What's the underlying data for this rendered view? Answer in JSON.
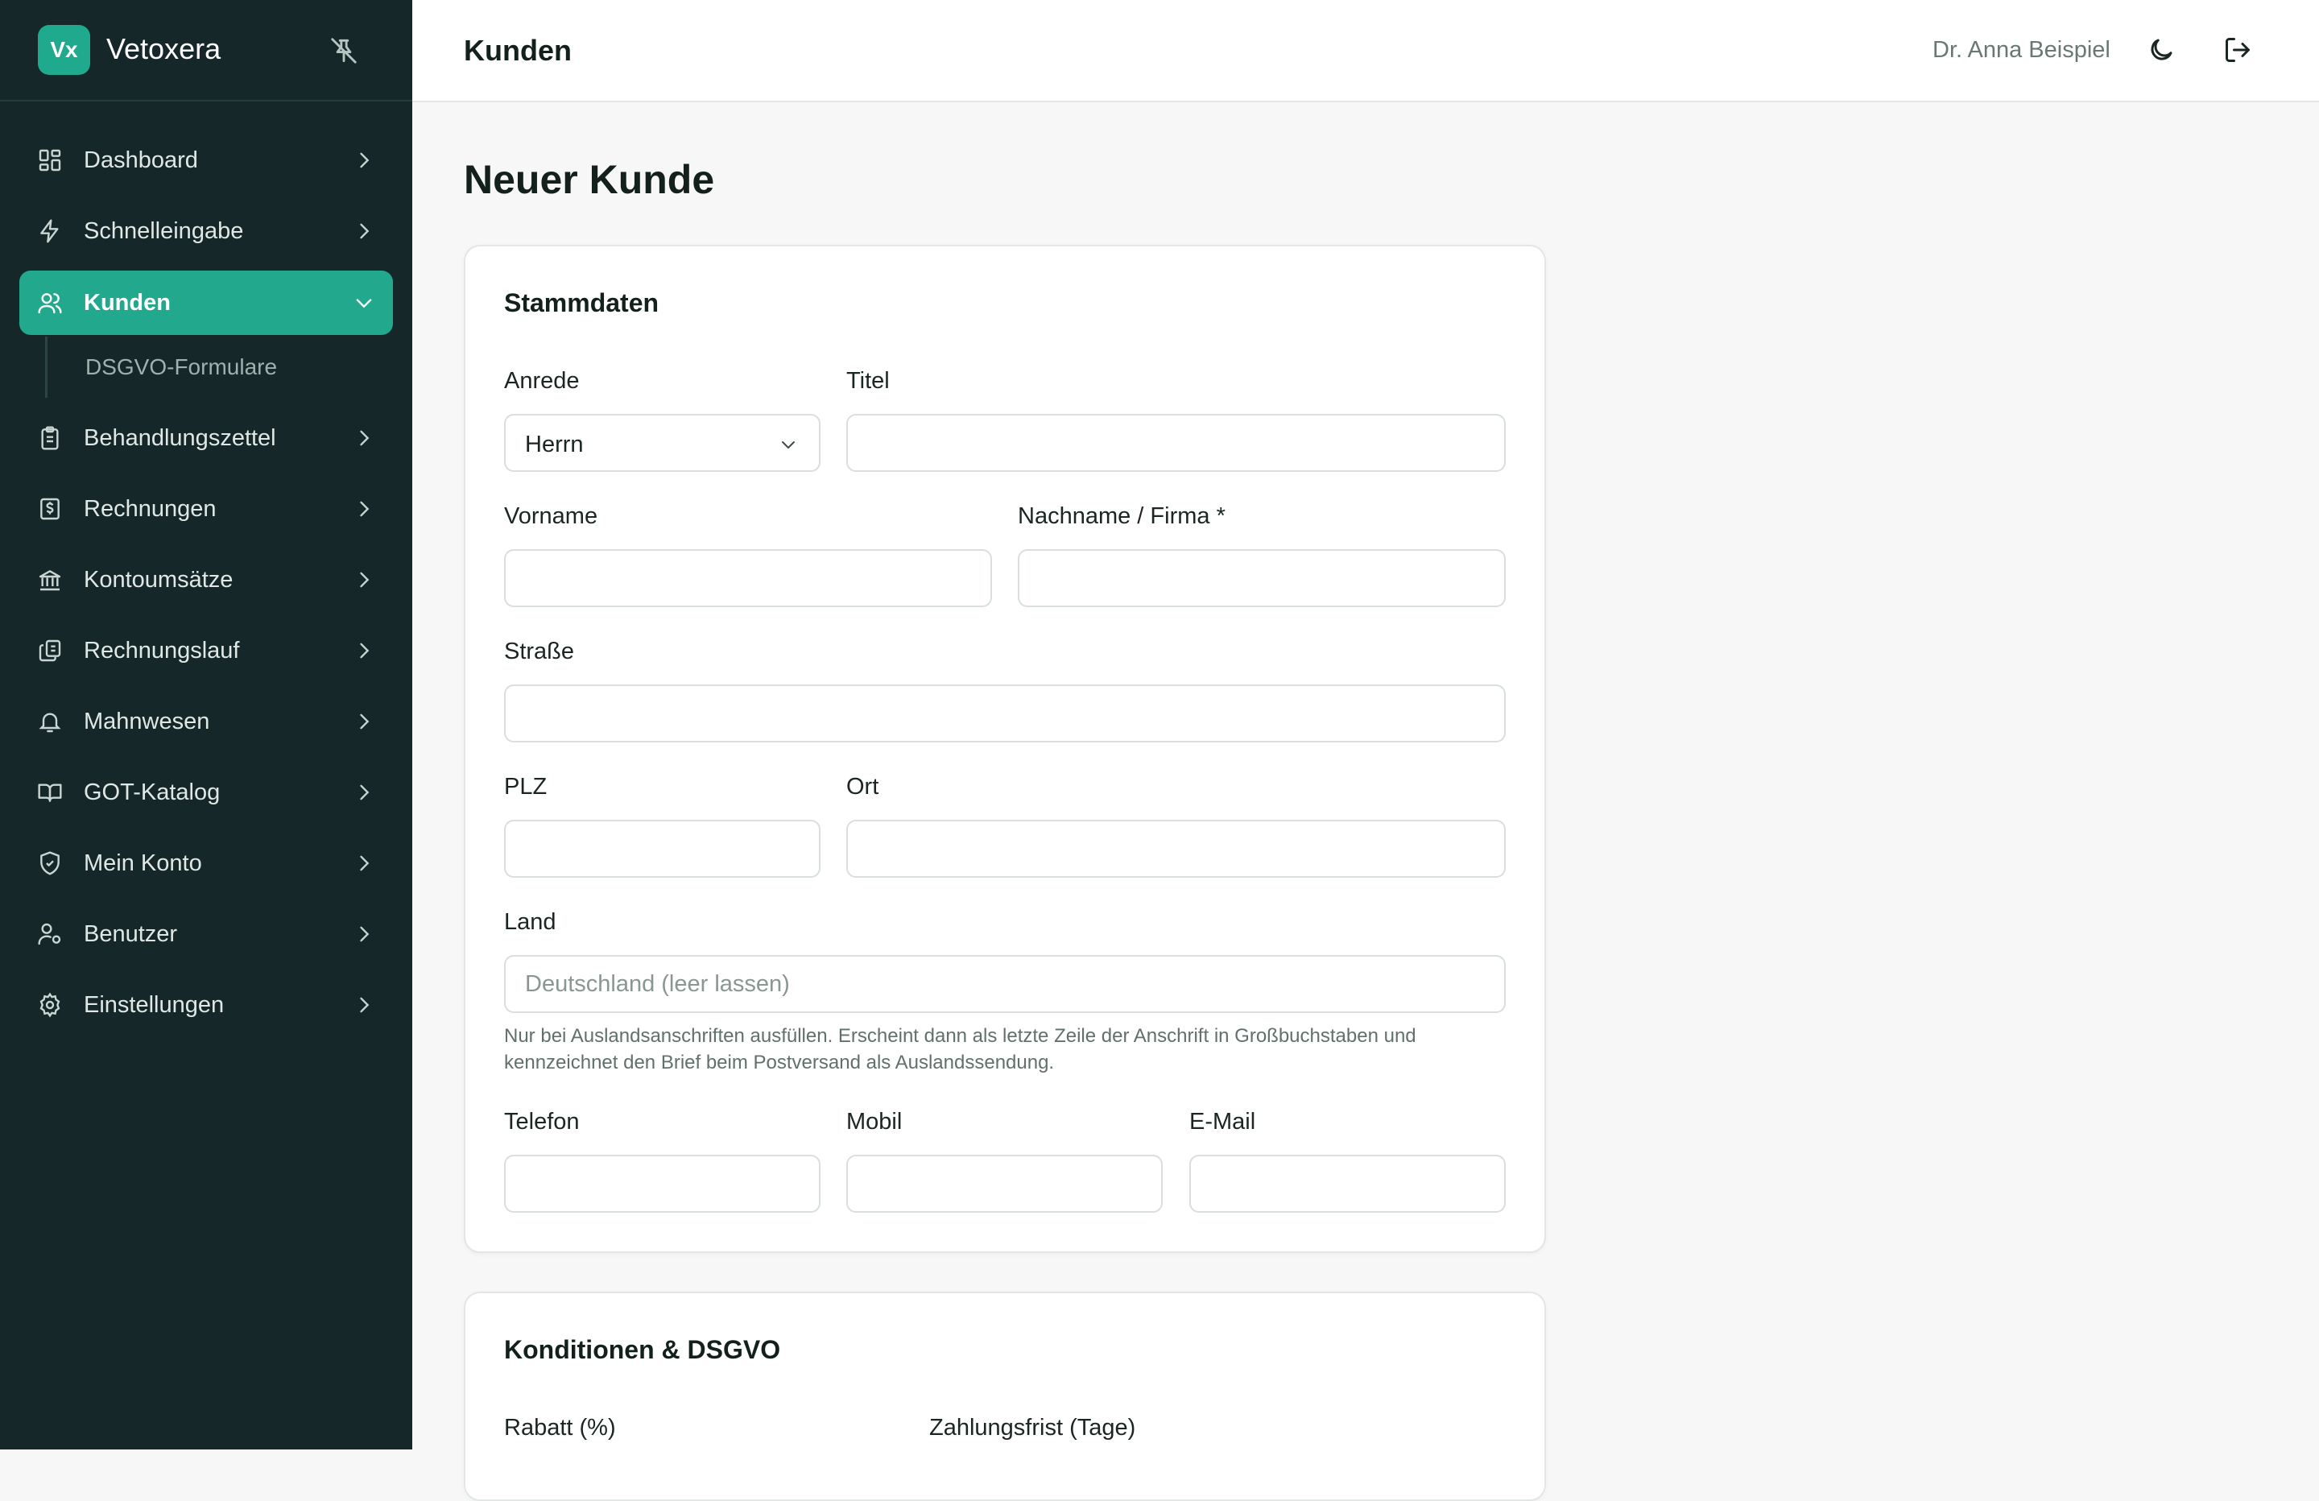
{
  "brand": {
    "logo_text": "Vx",
    "name": "Vetoxera"
  },
  "sidebar": {
    "items": [
      {
        "label": "Dashboard",
        "icon": "grid-icon"
      },
      {
        "label": "Schnelleingabe",
        "icon": "lightning-icon"
      },
      {
        "label": "Kunden",
        "icon": "users-icon",
        "active": true
      },
      {
        "label": "Behandlungszettel",
        "icon": "clipboard-icon"
      },
      {
        "label": "Rechnungen",
        "icon": "invoice-icon"
      },
      {
        "label": "Kontoumsätze",
        "icon": "bank-icon"
      },
      {
        "label": "Rechnungslauf",
        "icon": "copy-icon"
      },
      {
        "label": "Mahnwesen",
        "icon": "bell-icon"
      },
      {
        "label": "GOT-Katalog",
        "icon": "book-icon"
      },
      {
        "label": "Mein Konto",
        "icon": "shield-icon"
      },
      {
        "label": "Benutzer",
        "icon": "user-gear-icon"
      },
      {
        "label": "Einstellungen",
        "icon": "gear-icon"
      }
    ],
    "sub_item": "DSGVO-Formulare"
  },
  "topbar": {
    "title": "Kunden",
    "user": "Dr. Anna Beispiel"
  },
  "page": {
    "title": "Neuer Kunde"
  },
  "stammdaten": {
    "title": "Stammdaten",
    "anrede_label": "Anrede",
    "anrede_value": "Herrn",
    "titel_label": "Titel",
    "vorname_label": "Vorname",
    "nachname_label": "Nachname / Firma *",
    "strasse_label": "Straße",
    "plz_label": "PLZ",
    "ort_label": "Ort",
    "land_label": "Land",
    "land_placeholder": "Deutschland (leer lassen)",
    "land_hint": "Nur bei Auslandsanschriften ausfüllen. Erscheint dann als letzte Zeile der Anschrift in Großbuchstaben und kennzeichnet den Brief beim Postversand als Auslandssendung.",
    "telefon_label": "Telefon",
    "mobil_label": "Mobil",
    "email_label": "E-Mail"
  },
  "konditionen": {
    "title": "Konditionen & DSGVO",
    "rabatt_label": "Rabatt (%)",
    "zahlungsfrist_label": "Zahlungsfrist (Tage)"
  },
  "colors": {
    "sidebar_bg": "#16272a",
    "accent": "#22a98d",
    "page_bg": "#f6f7f6"
  }
}
